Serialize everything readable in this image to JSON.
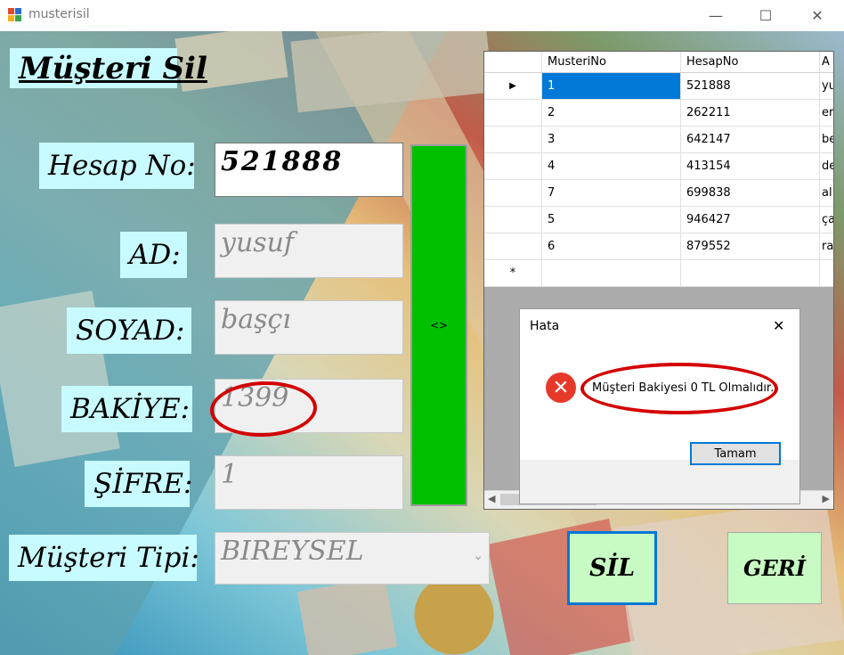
{
  "window": {
    "title": "musterisil",
    "minimize": "—",
    "maximize": "☐",
    "close": "✕"
  },
  "form": {
    "heading": "Müşteri Sil",
    "labels": {
      "hesap_no": "Hesap No:",
      "ad": "AD:",
      "soyad": "SOYAD:",
      "bakiye": "BAKİYE:",
      "sifre": "ŞİFRE:",
      "musteri_tipi": "Müşteri Tipi:"
    },
    "values": {
      "hesap_no": "521888",
      "ad": "yusuf",
      "soyad": "başçı",
      "bakiye": "1399",
      "sifre": "1",
      "musteri_tipi": "BIREYSEL"
    },
    "search_button": "<>",
    "sil_button": "SİL",
    "geri_button": "GERİ"
  },
  "grid": {
    "columns": [
      "MusteriNo",
      "HesapNo",
      "A"
    ],
    "rows": [
      {
        "no": "1",
        "hesap": "521888",
        "ad": "yu"
      },
      {
        "no": "2",
        "hesap": "262211",
        "ad": "er"
      },
      {
        "no": "3",
        "hesap": "642147",
        "ad": "be"
      },
      {
        "no": "4",
        "hesap": "413154",
        "ad": "de"
      },
      {
        "no": "7",
        "hesap": "699838",
        "ad": "al"
      },
      {
        "no": "5",
        "hesap": "946427",
        "ad": "ça"
      },
      {
        "no": "6",
        "hesap": "879552",
        "ad": "ra"
      }
    ],
    "current_row_marker": "▶",
    "new_row_marker": "*"
  },
  "dialog": {
    "title": "Hata",
    "message": "Müşteri Bakiyesi 0 TL Olmalıdır.",
    "ok_label": "Tamam",
    "close": "✕"
  },
  "colors": {
    "label_bg": "#c8fbff",
    "green": "#00c000",
    "action_bg": "#c8fac3",
    "annotation": "#d40000",
    "selection": "#0078d7"
  }
}
